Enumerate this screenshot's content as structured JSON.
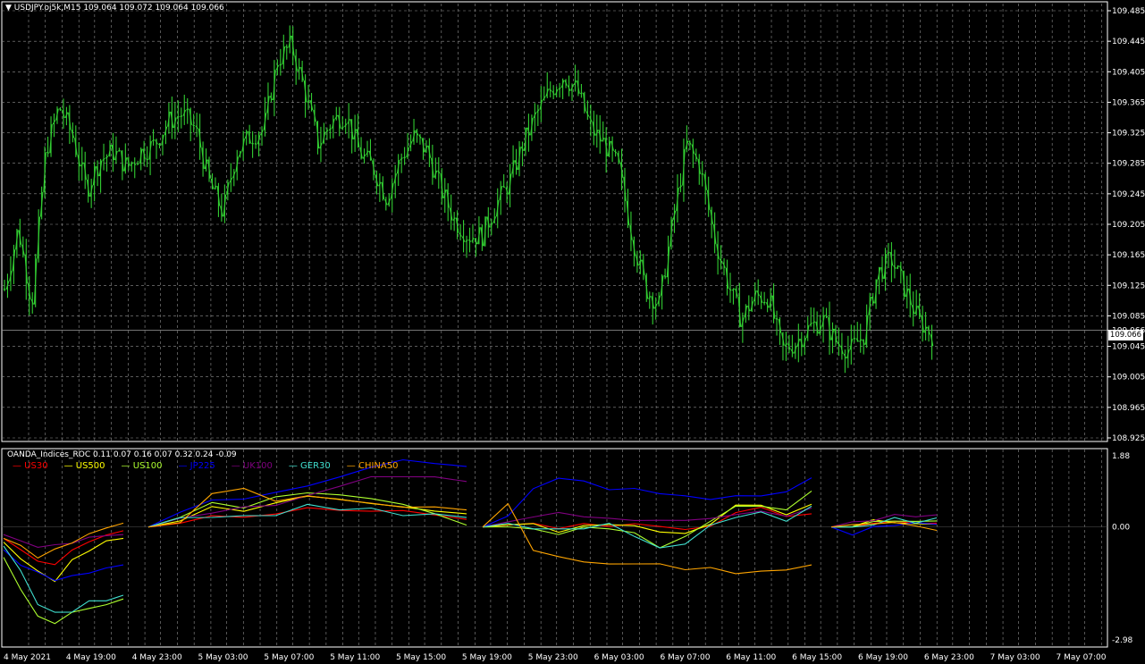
{
  "colors": {
    "background": "#000000",
    "grid": "#8f8f8f",
    "candle": "#32cd32",
    "frame": "#ffffff"
  },
  "header": {
    "symbol_title": "USDJPY.oj5k,M15  109.064 109.072 109.064 109.066",
    "indicator_title": "OANDA_Indices_ROC 0.11 0.07 0.16 0.07 0.32 0.24 -0.09",
    "current_price": "109.066"
  },
  "chart_data": [
    {
      "type": "candlestick",
      "title": "USDJPY.oj5k,M15",
      "ylim": [
        108.925,
        109.485
      ],
      "y_ticks": [
        "109.485",
        "109.445",
        "109.405",
        "109.365",
        "109.325",
        "109.285",
        "109.245",
        "109.205",
        "109.165",
        "109.125",
        "109.085",
        "109.066",
        "109.045",
        "109.005",
        "108.965",
        "108.925"
      ],
      "x_ticks": [
        "4 May 2021",
        "4 May 19:00",
        "4 May 23:00",
        "5 May 03:00",
        "5 May 07:00",
        "5 May 11:00",
        "5 May 15:00",
        "5 May 19:00",
        "5 May 23:00",
        "6 May 03:00",
        "6 May 07:00",
        "6 May 11:00",
        "6 May 15:00",
        "6 May 19:00",
        "6 May 23:00",
        "7 May 03:00",
        "7 May 07:00"
      ],
      "grid": true,
      "close_path": [
        109.12,
        109.2,
        109.1,
        109.3,
        109.36,
        109.32,
        109.25,
        109.29,
        109.3,
        109.28,
        109.3,
        109.31,
        109.34,
        109.35,
        109.33,
        109.26,
        109.22,
        109.3,
        109.32,
        109.33,
        109.42,
        109.44,
        109.38,
        109.31,
        109.34,
        109.35,
        109.3,
        109.28,
        109.24,
        109.29,
        109.32,
        109.3,
        109.25,
        109.21,
        109.19,
        109.19,
        109.23,
        109.26,
        109.31,
        109.35,
        109.38,
        109.4,
        109.38,
        109.33,
        109.31,
        109.28,
        109.19,
        109.12,
        109.1,
        109.21,
        109.31,
        109.28,
        109.19,
        109.13,
        109.08,
        109.11,
        109.11,
        109.04,
        109.05,
        109.07,
        109.08,
        109.05,
        109.04,
        109.06,
        109.14,
        109.16,
        109.12,
        109.08,
        109.06
      ]
    },
    {
      "type": "line",
      "title": "OANDA_Indices_ROC",
      "ylim": [
        -2.98,
        1.88
      ],
      "y_ticks": [
        "1.88",
        "0.00",
        "-2.98"
      ],
      "latest_values": [
        0.11,
        0.07,
        0.16,
        0.07,
        0.32,
        0.24,
        -0.09
      ],
      "series": [
        {
          "name": "US30",
          "color": "#ff0000",
          "segments": [
            [
              -0.3,
              -0.6,
              -0.9,
              -1.0,
              -0.6,
              -0.4,
              -0.2,
              -0.1
            ],
            [
              0.0,
              0.1,
              0.3,
              0.25,
              0.35,
              0.5,
              0.45,
              0.4,
              0.45,
              0.3,
              0.2
            ],
            [
              0.0,
              0.05,
              0.1,
              -0.05,
              0.1,
              0.0,
              0.1,
              0.0,
              -0.05,
              0.0,
              0.4,
              0.5,
              0.3,
              0.35
            ],
            [
              0.0,
              0.0,
              0.1,
              0.15,
              0.1,
              0.1
            ]
          ]
        },
        {
          "name": "US500",
          "color": "#ffff00",
          "segments": [
            [
              -0.4,
              -0.8,
              -1.2,
              -1.4,
              -0.9,
              -0.6,
              -0.4,
              -0.3
            ],
            [
              0.0,
              0.2,
              0.5,
              0.45,
              0.6,
              0.85,
              0.7,
              0.65,
              0.5,
              0.45,
              0.35
            ],
            [
              0.0,
              0.1,
              0.05,
              -0.1,
              0.0,
              0.1,
              0.0,
              -0.1,
              -0.2,
              0.1,
              0.55,
              0.6,
              0.3,
              0.6
            ],
            [
              0.0,
              0.05,
              0.15,
              0.15,
              0.05,
              0.07
            ]
          ]
        },
        {
          "name": "US100",
          "color": "#adff2f",
          "segments": [
            [
              -0.8,
              -1.6,
              -2.4,
              -2.5,
              -2.3,
              -2.1,
              -2.1,
              -1.9
            ],
            [
              0.0,
              0.3,
              0.6,
              0.55,
              0.75,
              0.95,
              0.8,
              0.8,
              0.55,
              0.4,
              0.05
            ],
            [
              0.0,
              0.05,
              -0.1,
              -0.15,
              -0.05,
              0.0,
              -0.2,
              -0.5,
              -0.3,
              0.2,
              0.5,
              0.6,
              0.4,
              0.95
            ],
            [
              0.0,
              0.05,
              0.1,
              0.2,
              0.1,
              0.16
            ]
          ]
        },
        {
          "name": "JP225",
          "color": "#0000ff",
          "segments": [
            [
              -0.6,
              -1.0,
              -1.2,
              -1.4,
              -1.3,
              -1.2,
              -1.1,
              -1.0
            ],
            [
              0.0,
              0.4,
              0.7,
              0.75,
              0.9,
              1.1,
              1.3,
              1.6,
              1.75,
              1.7,
              1.6
            ],
            [
              0.0,
              0.3,
              1.0,
              1.3,
              1.2,
              1.0,
              1.0,
              0.9,
              0.8,
              0.75,
              0.8,
              0.85,
              0.9,
              1.3
            ],
            [
              0.0,
              -0.2,
              0.0,
              0.05,
              0.1,
              0.07
            ]
          ]
        },
        {
          "name": "UK100",
          "color": "#800080",
          "segments": [
            [
              -0.2,
              -0.4,
              -0.5,
              -0.5,
              -0.4,
              -0.3,
              -0.2,
              -0.2
            ],
            [
              0.0,
              0.2,
              0.4,
              0.5,
              0.6,
              0.8,
              1.1,
              1.3,
              1.35,
              1.3,
              1.2
            ],
            [
              0.0,
              0.1,
              0.3,
              0.35,
              0.3,
              0.2,
              0.2,
              0.15,
              0.2,
              0.2,
              0.35,
              0.4,
              0.3,
              0.5
            ],
            [
              0.0,
              0.1,
              0.2,
              0.3,
              0.3,
              0.32
            ]
          ]
        },
        {
          "name": "GER30",
          "color": "#40e0d0",
          "segments": [
            [
              -0.5,
              -1.2,
              -2.0,
              -2.3,
              -2.2,
              -2.0,
              -1.9,
              -1.8
            ],
            [
              0.0,
              0.2,
              0.3,
              0.25,
              0.35,
              0.55,
              0.5,
              0.45,
              0.35,
              0.3,
              0.25
            ],
            [
              0.0,
              0.05,
              0.0,
              -0.1,
              0.0,
              0.05,
              -0.2,
              -0.6,
              -0.4,
              0.0,
              0.3,
              0.35,
              0.2,
              0.55
            ],
            [
              0.0,
              -0.05,
              0.1,
              0.2,
              0.15,
              0.24
            ]
          ]
        },
        {
          "name": "CHINA50",
          "color": "#ffa500",
          "segments": [
            [
              -0.3,
              -0.5,
              -0.8,
              -0.6,
              -0.4,
              -0.2,
              0.0,
              0.1
            ],
            [
              0.0,
              0.1,
              0.9,
              1.0,
              0.7,
              0.8,
              0.75,
              0.6,
              0.55,
              0.5,
              0.45
            ],
            [
              0.0,
              0.6,
              -0.6,
              -0.8,
              -0.9,
              -1.0,
              -0.95,
              -1.0,
              -1.1,
              -1.1,
              -1.2,
              -1.2,
              -1.1,
              -1.0
            ],
            [
              0.0,
              0.05,
              0.1,
              0.1,
              0.05,
              -0.09
            ]
          ]
        }
      ]
    }
  ]
}
